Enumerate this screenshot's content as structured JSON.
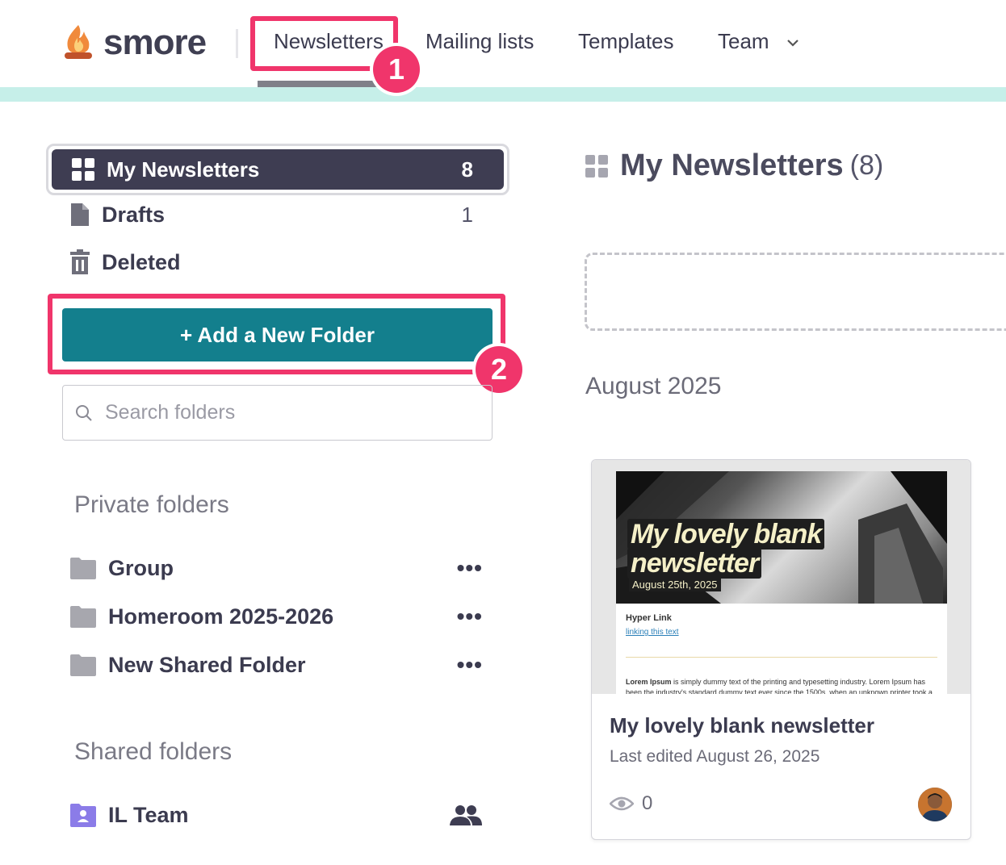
{
  "header": {
    "logo_text": "smore",
    "nav": [
      "Newsletters",
      "Mailing lists",
      "Templates",
      "Team"
    ],
    "annotation_1": "1"
  },
  "sidebar": {
    "my_newsletters": {
      "label": "My Newsletters",
      "count": "8"
    },
    "drafts": {
      "label": "Drafts",
      "count": "1"
    },
    "deleted": {
      "label": "Deleted"
    },
    "add_folder_label": "+ Add a New Folder",
    "annotation_2": "2",
    "search_placeholder": "Search folders",
    "private_title": "Private folders",
    "private_folders": [
      "Group",
      "Homeroom 2025-2026",
      "New Shared Folder"
    ],
    "shared_title": "Shared folders",
    "shared_folders": [
      "IL Team"
    ],
    "more_glyph": "•••"
  },
  "main": {
    "title": "My Newsletters",
    "count": "(8)",
    "month": "August 2025",
    "card": {
      "thumb_title_line1": "My lovely blank",
      "thumb_title_line2": "newsletter",
      "thumb_date": "August 25th, 2025",
      "thumb_hyperlink_heading": "Hyper Link",
      "thumb_link_text": "linking this text",
      "thumb_body_bold": "Lorem Ipsum",
      "thumb_body": " is simply dummy text of the printing and typesetting industry. Lorem Ipsum has been the industry's standard dummy text ever since the 1500s, when an unknown printer took a galley of",
      "title": "My lovely blank newsletter",
      "subtitle": "Last edited August 26, 2025",
      "views": "0"
    }
  },
  "colors": {
    "highlight": "#f0356b",
    "button": "#137f8d",
    "dark_nav": "#3e3d52",
    "teal_band": "#c6efe9",
    "shared_folder_icon": "#8b7ce8"
  }
}
